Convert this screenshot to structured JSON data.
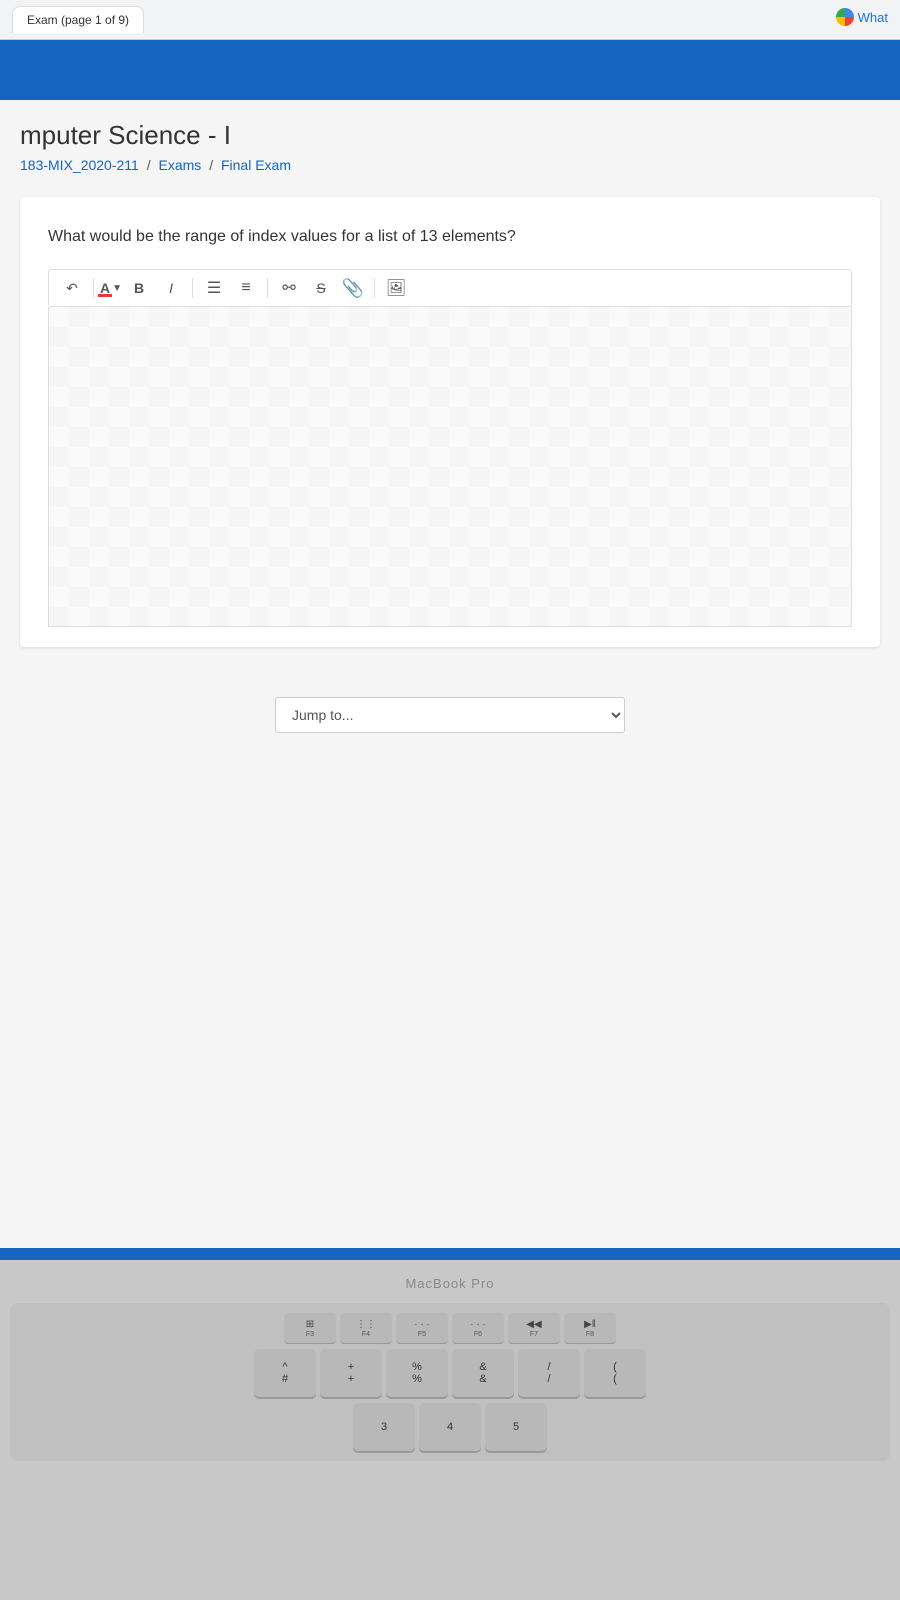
{
  "browser": {
    "tab_label": "Exam (page 1 of 9)",
    "google_tab_label": "What"
  },
  "site": {
    "course_title": "mputer Science - I",
    "course_code": "183-MIX_2020-211",
    "breadcrumb": {
      "course": "183-MIX_2020-211",
      "section": "Exams",
      "page": "Final Exam"
    }
  },
  "question": {
    "text": "What would be the range of index values for a list of 13 elements?"
  },
  "toolbar": {
    "undo_label": "↶",
    "font_color_label": "A",
    "bold_label": "B",
    "italic_label": "I",
    "unordered_list_label": "≡",
    "ordered_list_label": "≡",
    "link_label": "⚯",
    "strikethrough_label": "S̶",
    "embed_label": "📎",
    "image_label": "🖼"
  },
  "jump": {
    "placeholder": "Jump to..."
  },
  "keyboard": {
    "macbook_label": "MacBook Pro",
    "fn_keys": [
      {
        "icon": "⊞",
        "label": "F3"
      },
      {
        "icon": "⋮⋮⋮",
        "label": "F4"
      },
      {
        "icon": "···",
        "label": "F5"
      },
      {
        "icon": "···",
        "label": "F6"
      },
      {
        "icon": "◀◀",
        "label": "F7"
      },
      {
        "icon": "▶‖",
        "label": "F8"
      }
    ],
    "num_row": [
      {
        "top": "^",
        "bot": "^"
      },
      {
        "top": "#",
        "bot": "#"
      },
      {
        "top": "+",
        "bot": "+"
      },
      {
        "top": "%",
        "bot": "%"
      },
      {
        "top": "&",
        "bot": "&"
      },
      {
        "top": "/",
        "bot": "/"
      },
      {
        "top": "(",
        "bot": "("
      }
    ],
    "bottom_keys": [
      {
        "top": "",
        "bot": "3"
      },
      {
        "top": "",
        "bot": "4"
      },
      {
        "top": "",
        "bot": "5"
      }
    ]
  }
}
